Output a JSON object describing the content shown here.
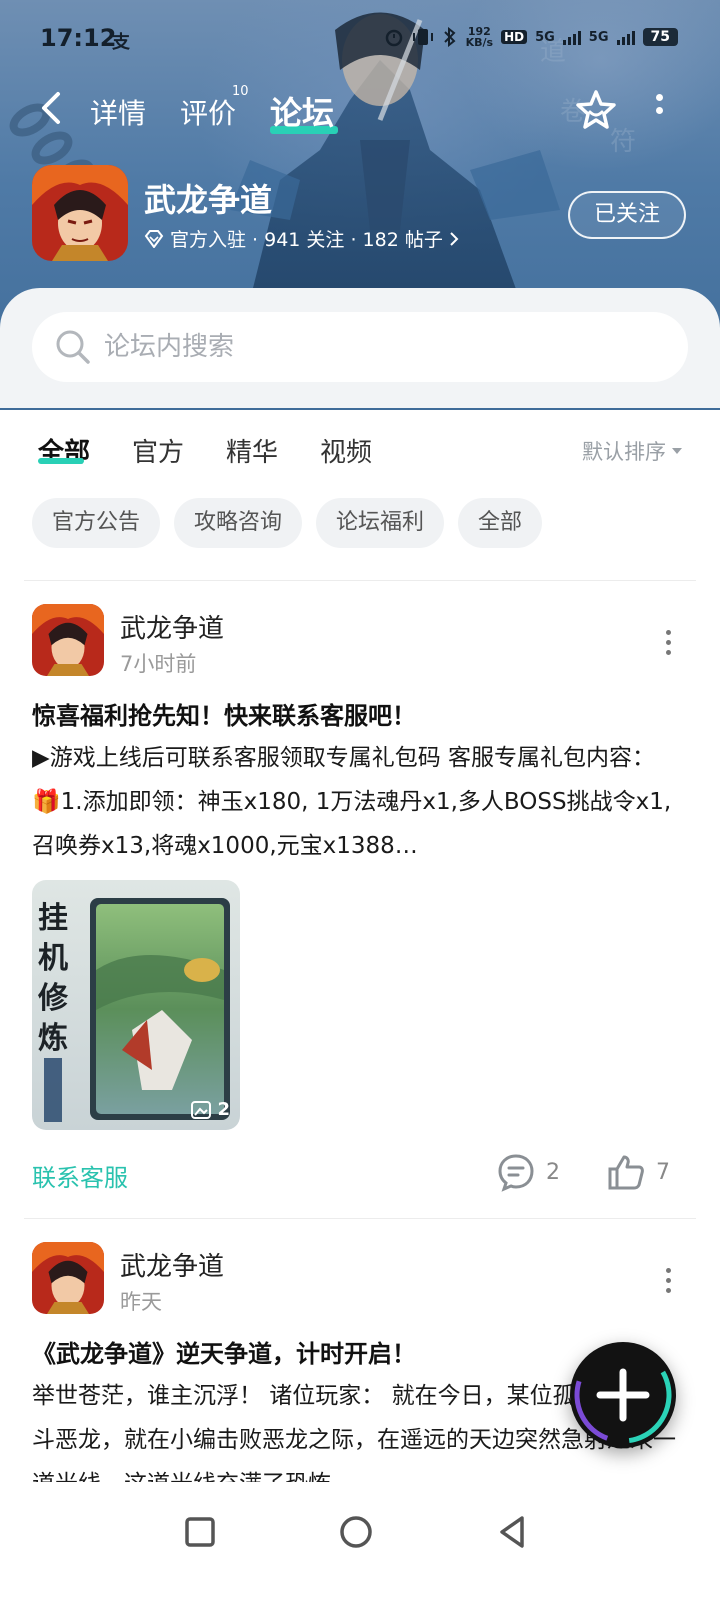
{
  "status_bar": {
    "time": "17:12",
    "alipay_icon": "支",
    "net_speed_value": "192",
    "net_speed_unit": "KB/s",
    "hd_label": "HD",
    "sim1_label": "5G",
    "sim2_label": "5G",
    "battery": "75"
  },
  "nav": {
    "tabs": [
      {
        "label": "详情"
      },
      {
        "label": "评价",
        "badge": "10"
      },
      {
        "label": "论坛",
        "active": true
      }
    ]
  },
  "game": {
    "title": "武龙争道",
    "meta": "官方入驻 · 941 关注 · 182 帖子",
    "follow_label": "已关注"
  },
  "search": {
    "placeholder": "论坛内搜索"
  },
  "filter": {
    "tabs": [
      "全部",
      "官方",
      "精华",
      "视频"
    ],
    "active_tab": "全部",
    "sort_label": "默认排序",
    "chips": [
      "官方公告",
      "攻略咨询",
      "论坛福利",
      "全部"
    ]
  },
  "posts": [
    {
      "author": "武龙争道",
      "time": "7小时前",
      "title": "惊喜福利抢先知！快来联系客服吧！",
      "body": "▶游戏上线后可联系客服领取专属礼包码 客服专属礼包内容：  🎁1.添加即领：神玉x180, 1万法魂丹x1,多人BOSS挑战令x1,召唤券x13,将魂x1000,元宝x1388…",
      "image_count": "2",
      "link_label": "联系客服",
      "comments": "2",
      "likes": "7"
    },
    {
      "author": "武龙争道",
      "time": "昨天",
      "title": "《武龙争道》逆天争道，计时开启！",
      "body": "举世苍茫，谁主沉浮！ 诸位玩家：   就在今日，某位孤身勇者勇斗恶龙，就在小编击败恶龙之际，在遥远的天边突然急射过来一道光线，这道光线充满了恐怖"
    }
  ],
  "colors": {
    "accent": "#29d0b6",
    "link": "#29c2ae",
    "banner": "#4f7aa6"
  }
}
